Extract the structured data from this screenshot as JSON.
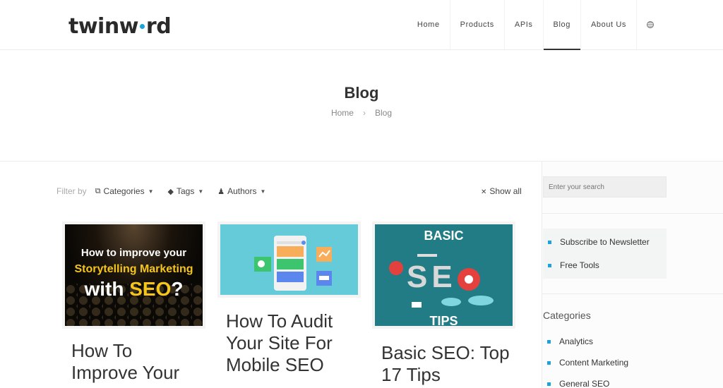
{
  "header": {
    "logo": {
      "pre": "twinw",
      "post": "rd"
    },
    "nav": [
      {
        "label": "Home",
        "active": false
      },
      {
        "label": "Products",
        "active": false
      },
      {
        "label": "APIs",
        "active": false
      },
      {
        "label": "Blog",
        "active": true
      },
      {
        "label": "About Us",
        "active": false
      }
    ],
    "language_icon": "globe-icon"
  },
  "page": {
    "title": "Blog",
    "breadcrumb": [
      "Home",
      "Blog"
    ],
    "breadcrumb_separator": "›"
  },
  "filter": {
    "label": "Filter by",
    "items": [
      {
        "label": "Categories",
        "icon": "categories-icon"
      },
      {
        "label": "Tags",
        "icon": "tag-icon"
      },
      {
        "label": "Authors",
        "icon": "user-icon"
      }
    ],
    "show_all": "Show all"
  },
  "posts": [
    {
      "title": "How To Improve Your",
      "thumb": {
        "line1": "How to improve your",
        "line2": "Storytelling Marketing",
        "line3a": "with ",
        "line3b": "SEO",
        "line3c": "?"
      }
    },
    {
      "title": "How To Audit Your Site For Mobile SEO"
    },
    {
      "title": "Basic SEO: Top 17 Tips",
      "thumb": {
        "top": "BASIC",
        "mid": "SE",
        "bottom": "TIPS"
      }
    }
  ],
  "sidebar": {
    "search_placeholder": "Enter your search",
    "links": [
      "Subscribe to Newsletter",
      "Free Tools"
    ],
    "categories_heading": "Categories",
    "categories": [
      "Analytics",
      "Content Marketing",
      "General SEO"
    ],
    "accent_color": "#1ba3dc"
  }
}
